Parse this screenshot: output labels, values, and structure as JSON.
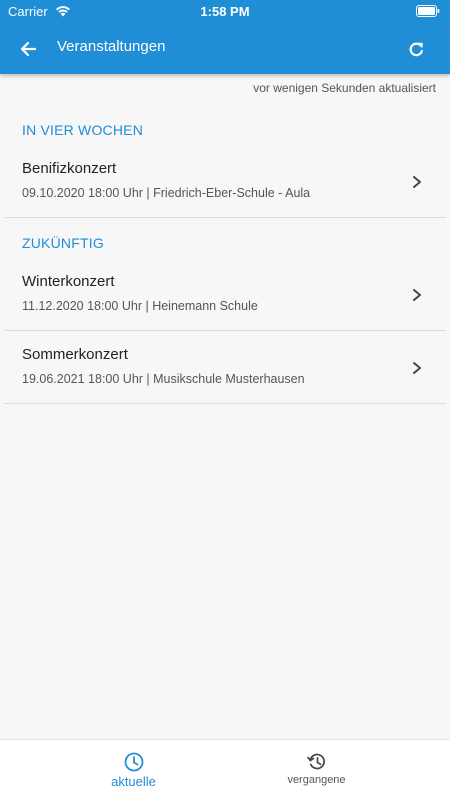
{
  "status_bar": {
    "carrier": "Carrier",
    "time": "1:58 PM"
  },
  "nav": {
    "title": "Veranstaltungen",
    "back_icon": "arrow-left-icon",
    "refresh_icon": "refresh-icon"
  },
  "updated_text": "vor wenigen Sekunden aktualisiert",
  "sections": [
    {
      "title": "IN VIER WOCHEN",
      "events": [
        {
          "title": "Benifizkonzert",
          "details": "09.10.2020 18:00 Uhr | Friedrich-Eber-Schule - Aula"
        }
      ]
    },
    {
      "title": "ZUKÜNFTIG",
      "events": [
        {
          "title": "Winterkonzert",
          "details": "11.12.2020 18:00 Uhr | Heinemann Schule"
        },
        {
          "title": "Sommerkonzert",
          "details": "19.06.2021 18:00 Uhr | Musikschule Musterhausen"
        }
      ]
    }
  ],
  "tabs": [
    {
      "label": "aktuelle",
      "icon": "clock-icon",
      "active": true
    },
    {
      "label": "vergangene",
      "icon": "history-icon",
      "active": false
    }
  ],
  "colors": {
    "accent": "#1f8ed6",
    "background": "#f7f7f7"
  }
}
